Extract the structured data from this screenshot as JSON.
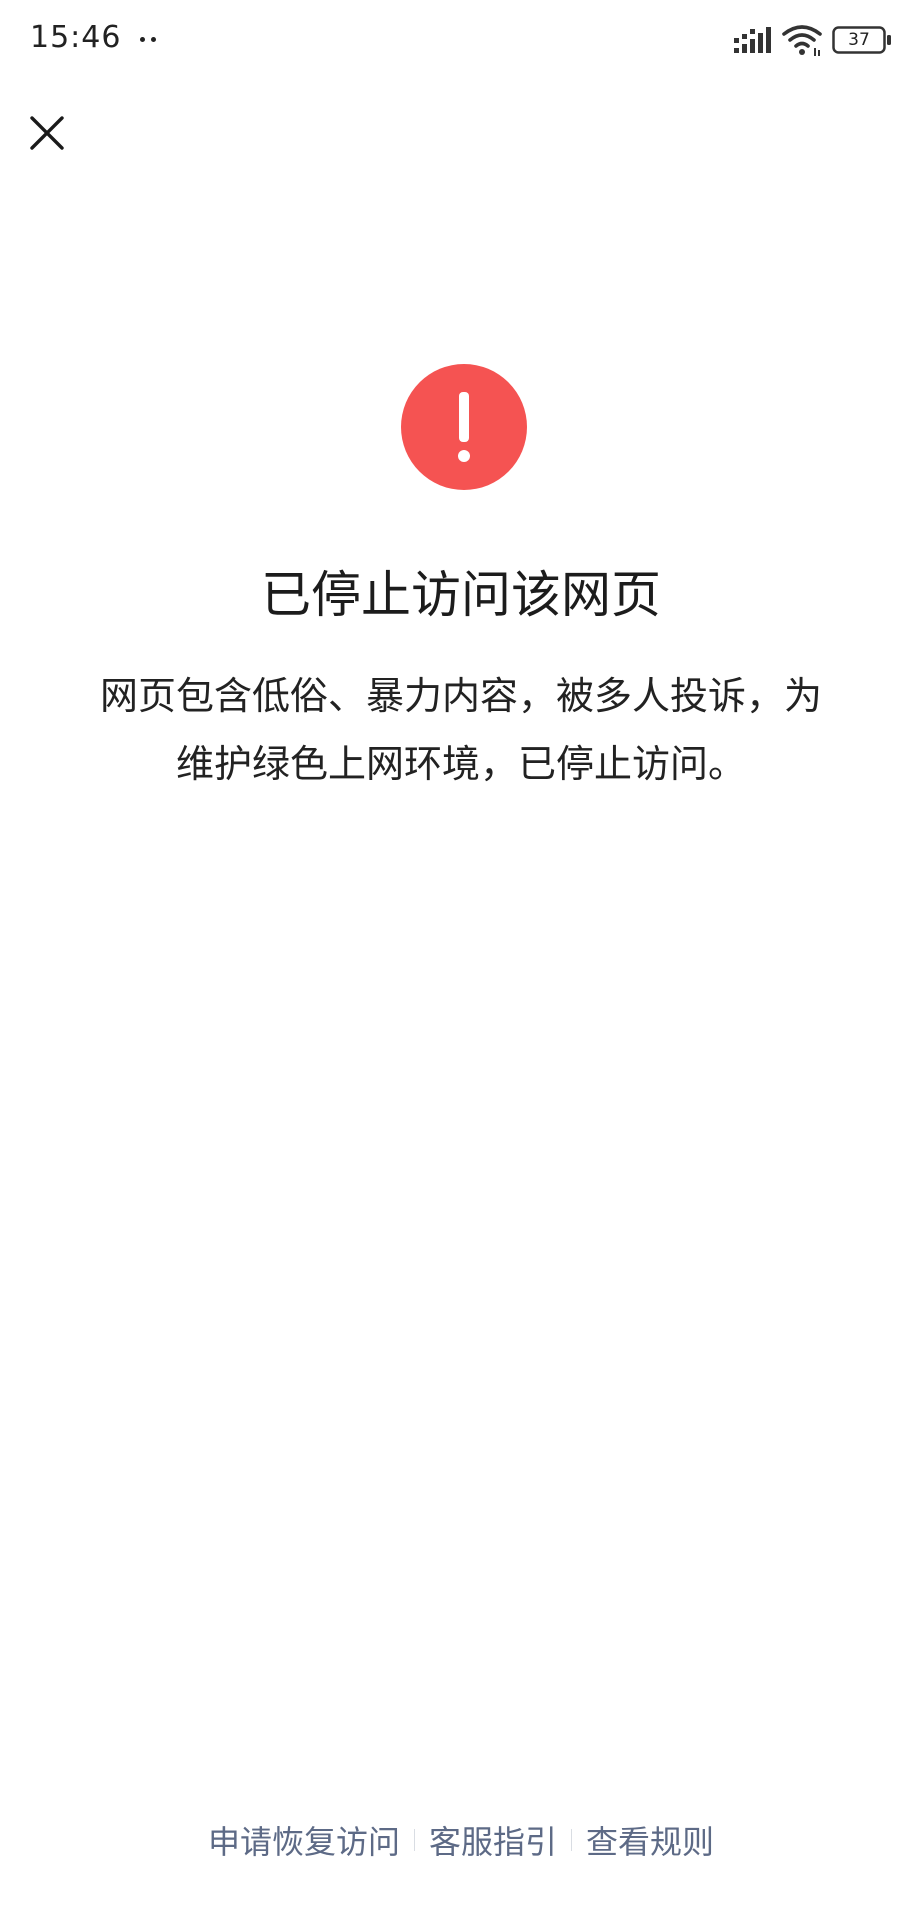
{
  "status_bar": {
    "time": "15:46",
    "battery_level": "37"
  },
  "icons": {
    "close": "close-icon",
    "warning": "exclamation-icon"
  },
  "colors": {
    "warning": "#f55352",
    "link": "#5d6a86"
  },
  "content": {
    "title": "已停止访问该网页",
    "message_line1": "网页包含低俗、暴力内容，被多人投诉，为",
    "message_line2": "维护绿色上网环境，已停止访问。"
  },
  "footer": {
    "links": [
      {
        "label": "申请恢复访问"
      },
      {
        "label": "客服指引"
      },
      {
        "label": "查看规则"
      }
    ]
  }
}
